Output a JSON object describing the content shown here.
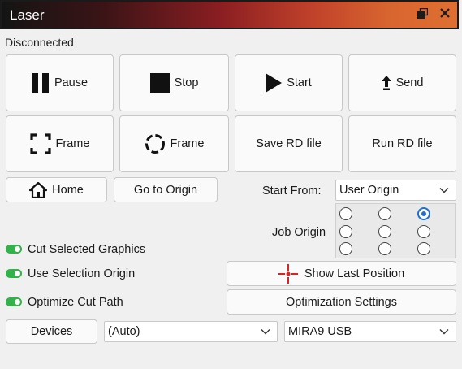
{
  "window": {
    "title": "Laser",
    "float_icon": "float-window-icon",
    "close_icon": "close-icon"
  },
  "status": "Disconnected",
  "buttons": {
    "pause": "Pause",
    "stop": "Stop",
    "start": "Start",
    "send": "Send",
    "frame_rect": "Frame",
    "frame_circle": "Frame",
    "save_rd": "Save RD file",
    "run_rd": "Run RD file",
    "home": "Home",
    "go_to_origin": "Go to Origin",
    "show_last_position": "Show Last Position",
    "optimization_settings": "Optimization Settings",
    "devices": "Devices"
  },
  "start_from": {
    "label": "Start From:",
    "value": "User Origin"
  },
  "job_origin": {
    "label": "Job Origin",
    "selected": "top-right"
  },
  "options": [
    {
      "label": "Cut Selected Graphics",
      "enabled": true
    },
    {
      "label": "Use Selection Origin",
      "enabled": true
    },
    {
      "label": "Optimize Cut Path",
      "enabled": true
    }
  ],
  "port_select": {
    "value": "(Auto)"
  },
  "device_select": {
    "value": "MIRA9 USB"
  },
  "colors": {
    "toggle_on": "#33b24a",
    "radio_selected": "#1f6fd4",
    "crosshair": "#e02020"
  }
}
